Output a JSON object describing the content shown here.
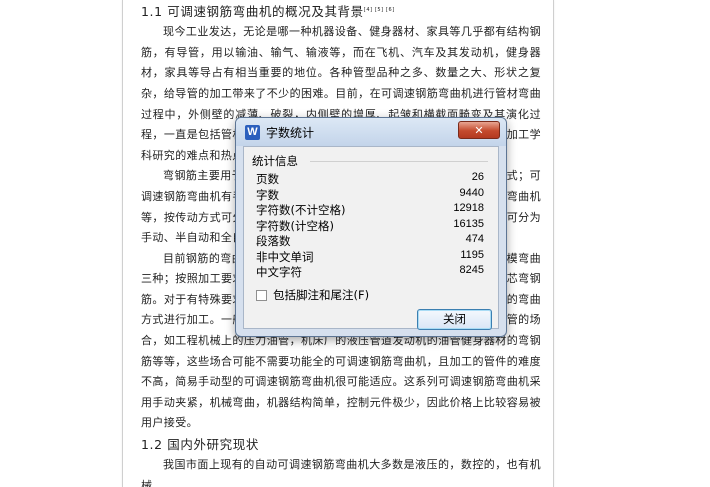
{
  "document": {
    "heading1": "1.1  可调速钢筋弯曲机的概况及其背景",
    "heading1_refs": "[4] [5] [6]",
    "paragraphs": [
      "现今工业发达，无论是哪一种机器设备、健身器材、家具等几乎都有结构钢筋，有导管，用以输油、输气、输液等，而在飞机、汽车及其发动机，健身器材，家具等导占有相当重要的地位。各种管型品种之多、数量之大、形状之复杂，给导管的加工带来了不少的困难。目前，在可调速钢筋弯曲机进行管材弯曲过程中，外侧壁的减薄、破裂，内侧壁的增厚、起皱和横截面畸变及其演化过程，一直是包括管材弯曲成形在内的工程技术领域的重要问题，也是塑性加工学科研究的难点和热点。上述问题日益引起国内外学者的关注和应用推广。",
      "弯钢筋主要用于，按弯管方式可分为绕弯式、推弯式、压弯式和滚弯式；可调速钢筋弯曲机有手动弯曲机、机械式可调速钢筋弯曲机和热可调速钢筋弯曲机等，按传动方式可分为机械传动、液压传动和液压传动四种，按控制方式可分为手动、半自动和全自动等。",
      "目前钢筋的弯曲加工方式主要有：冷弯、热弯、中频加热弯管以及无模弯曲三种；按照加工要求、管材材料、弯曲半径等不同可分为有芯弯钢筋和无芯弯钢筋。对于有特殊要求的可调速钢筋弯曲，有较高的工艺难度，也采用其他的弯曲方式进行加工。一般的钢筋弯曲机多用于家庭作坊，或者大企业中需要配管的场合，如工程机械上的压力油管，机床厂的液压管道发动机的油管健身器材的弯钢筋等等，这些场合可能不需要功能全的可调速钢筋弯曲机，且加工的管件的难度不高，简易手动型的可调速钢筋弯曲机很可能适应。这系列可调速钢筋弯曲机采用手动夹紧，机械弯曲，机器结构简单，控制元件极少，因此价格上比较容易被用户接受。"
    ],
    "heading2": "1.2  国内外研究现状",
    "paragraph_last": "我国市面上现有的自动可调速钢筋弯曲机大多数是液压的，数控的，也有机械"
  },
  "dialog": {
    "title": "字数统计",
    "app_icon": "W",
    "close_glyph": "✕",
    "group_title": "统计信息",
    "stats": [
      {
        "label": "页数",
        "value": "26"
      },
      {
        "label": "字数",
        "value": "9440"
      },
      {
        "label": "字符数(不计空格)",
        "value": "12918"
      },
      {
        "label": "字符数(计空格)",
        "value": "16135"
      },
      {
        "label": "段落数",
        "value": "474"
      },
      {
        "label": "非中文单词",
        "value": "1195"
      },
      {
        "label": "中文字符",
        "value": "8245"
      }
    ],
    "checkbox_label": "包括脚注和尾注(F)",
    "checkbox_checked": false,
    "close_button_label": "关闭"
  },
  "colors": {
    "dialog_frame": "#d6e0ee",
    "close_button": "#c44a2d",
    "app_icon": "#2b5fbd",
    "button_focus_border": "#3c7fb1"
  },
  "icons": {
    "app": "wps-writer-icon",
    "close": "close-icon",
    "checkbox": "checkbox-unchecked"
  }
}
